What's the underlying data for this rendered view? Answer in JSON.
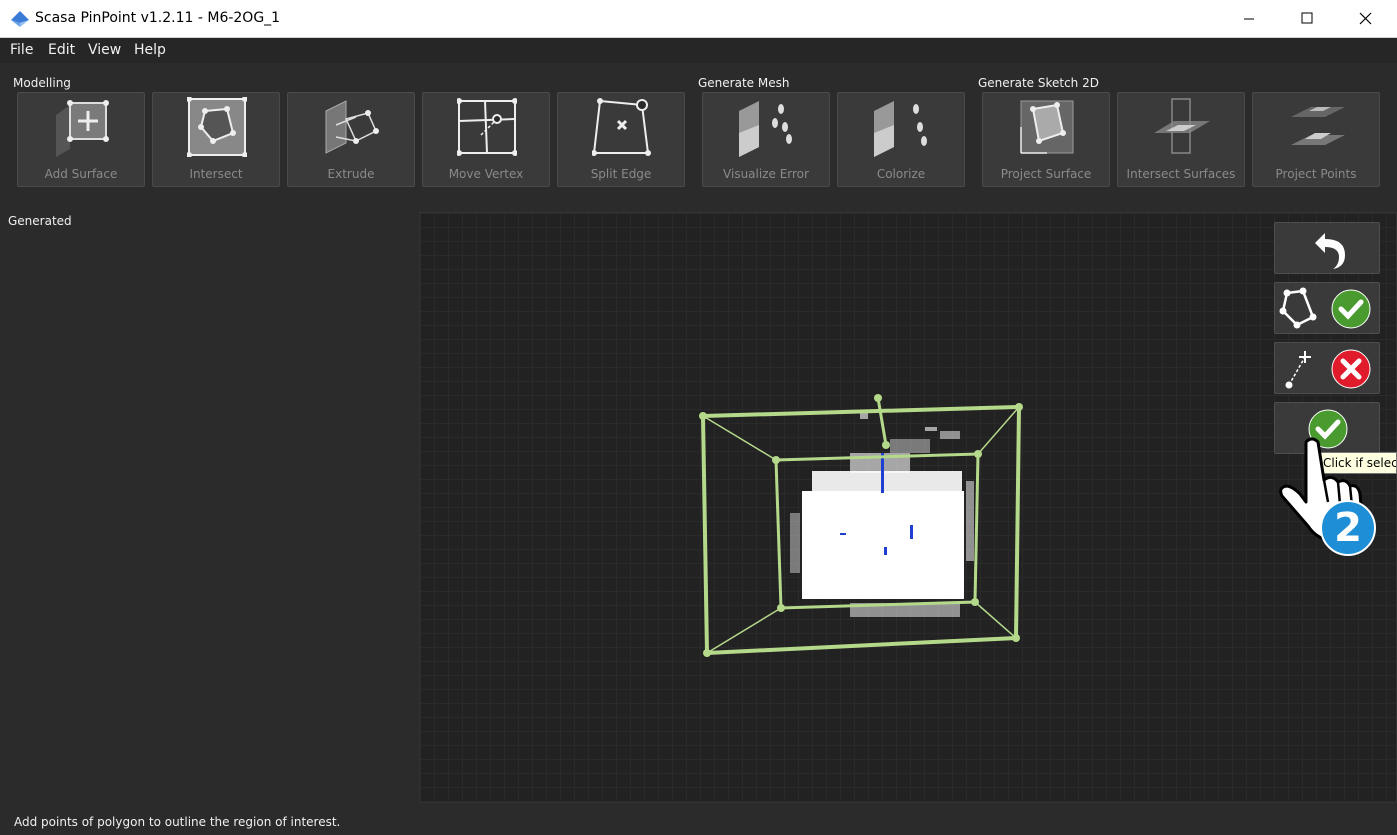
{
  "window": {
    "title": "Scasa PinPoint v1.2.11 - M6-2OG_1",
    "controls": [
      "minimize",
      "maximize",
      "close"
    ]
  },
  "menu": [
    "File",
    "Edit",
    "View",
    "Help"
  ],
  "toolbar": {
    "groups": [
      {
        "label": "Modelling",
        "tools": [
          "Add Surface",
          "Intersect",
          "Extrude",
          "Move Vertex",
          "Split Edge"
        ]
      },
      {
        "label": "Generate Mesh",
        "tools": [
          "Visualize Error",
          "Colorize"
        ]
      },
      {
        "label": "Generate Sketch 2D",
        "tools": [
          "Project Surface",
          "Intersect Surfaces",
          "Project Points"
        ]
      }
    ]
  },
  "left_panel": {
    "title": "Generated"
  },
  "viewport": {
    "bbox_color": "#b5d98a",
    "point_color": "#ffffff",
    "accent": "#1f3fd0"
  },
  "side_buttons": [
    {
      "icon": "undo-icon"
    },
    {
      "icon": "polygon-confirm-icon",
      "status_color": "#4a9b2f"
    },
    {
      "icon": "vertex-cancel-icon",
      "status_color": "#e01b2b"
    },
    {
      "icon": "confirm-icon",
      "status_color": "#4a9b2f"
    }
  ],
  "tooltip": "Click if selec",
  "cursor": {
    "icon": "hand-pointer-icon",
    "step_badge": "2",
    "badge_color": "#1e8fd6"
  },
  "status": "Add points of polygon to outline the region of interest."
}
